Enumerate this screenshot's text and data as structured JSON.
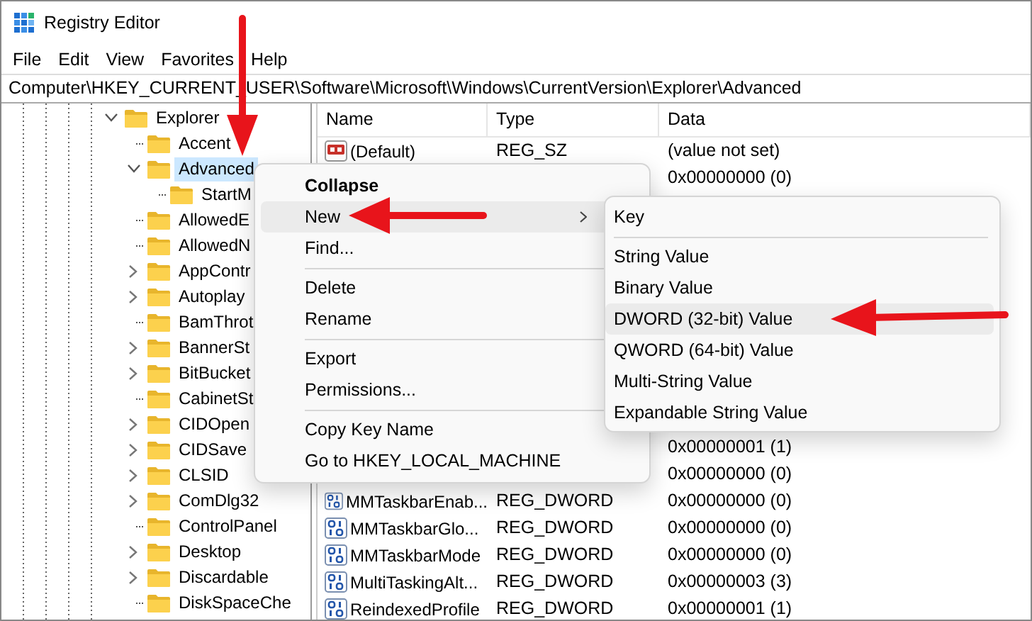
{
  "window": {
    "title": "Registry Editor"
  },
  "menu_bar": [
    "File",
    "Edit",
    "View",
    "Favorites",
    "Help"
  ],
  "address": "Computer\\HKEY_CURRENT_USER\\Software\\Microsoft\\Windows\\CurrentVersion\\Explorer\\Advanced",
  "tree": [
    {
      "label": "Explorer",
      "kind": "branch",
      "expanded": true,
      "selected": false,
      "children": [
        {
          "label": "Accent",
          "kind": "leaf",
          "selected": false
        },
        {
          "label": "Advanced",
          "kind": "branch",
          "expanded": true,
          "selected": true,
          "children": [
            {
              "label": "StartM",
              "kind": "leaf",
              "selected": false
            }
          ]
        },
        {
          "label": "AllowedE",
          "kind": "leaf",
          "selected": false
        },
        {
          "label": "AllowedN",
          "kind": "leaf",
          "selected": false
        },
        {
          "label": "AppContr",
          "kind": "branch",
          "expanded": false,
          "selected": false
        },
        {
          "label": "Autoplay",
          "kind": "branch",
          "expanded": false,
          "selected": false
        },
        {
          "label": "BamThrot",
          "kind": "leaf",
          "selected": false
        },
        {
          "label": "BannerSt",
          "kind": "branch",
          "expanded": false,
          "selected": false
        },
        {
          "label": "BitBucket",
          "kind": "branch",
          "expanded": false,
          "selected": false
        },
        {
          "label": "CabinetSt",
          "kind": "leaf",
          "selected": false
        },
        {
          "label": "CIDOpen",
          "kind": "branch",
          "expanded": false,
          "selected": false
        },
        {
          "label": "CIDSave",
          "kind": "branch",
          "expanded": false,
          "selected": false
        },
        {
          "label": "CLSID",
          "kind": "branch",
          "expanded": false,
          "selected": false
        },
        {
          "label": "ComDlg32",
          "kind": "branch",
          "expanded": false,
          "selected": false
        },
        {
          "label": "ControlPanel",
          "kind": "leaf",
          "selected": false
        },
        {
          "label": "Desktop",
          "kind": "branch",
          "expanded": false,
          "selected": false
        },
        {
          "label": "Discardable",
          "kind": "branch",
          "expanded": false,
          "selected": false
        },
        {
          "label": "DiskSpaceChe",
          "kind": "leaf",
          "selected": false
        }
      ]
    }
  ],
  "values": {
    "columns": [
      "Name",
      "Type",
      "Data"
    ],
    "rows": [
      {
        "kind": "string",
        "name": "(Default)",
        "type": "REG_SZ",
        "data": "(value not set)"
      },
      {
        "data": "0x00000000 (0)"
      },
      {
        "data": "0x00000001 (1)"
      },
      {
        "data": "0x00000000 (0)"
      },
      {
        "kind": "dword",
        "name": "MMTaskbarEnab...",
        "type": "REG_DWORD",
        "data": "0x00000000 (0)"
      },
      {
        "kind": "dword",
        "name": "MMTaskbarGlo...",
        "type": "REG_DWORD",
        "data": "0x00000000 (0)"
      },
      {
        "kind": "dword",
        "name": "MMTaskbarMode",
        "type": "REG_DWORD",
        "data": "0x00000000 (0)"
      },
      {
        "kind": "dword",
        "name": "MultiTaskingAlt...",
        "type": "REG_DWORD",
        "data": "0x00000003 (3)"
      },
      {
        "kind": "dword",
        "name": "ReindexedProfile",
        "type": "REG_DWORD",
        "data": "0x00000001 (1)"
      }
    ]
  },
  "context_menu": [
    {
      "kind": "item",
      "label": "Collapse",
      "default": true,
      "selected": false
    },
    {
      "kind": "item",
      "label": "New",
      "submenu": true,
      "selected": true
    },
    {
      "kind": "item",
      "label": "Find...",
      "selected": false
    },
    {
      "kind": "separator"
    },
    {
      "kind": "item",
      "label": "Delete",
      "selected": false
    },
    {
      "kind": "item",
      "label": "Rename",
      "selected": false
    },
    {
      "kind": "separator"
    },
    {
      "kind": "item",
      "label": "Export",
      "selected": false
    },
    {
      "kind": "item",
      "label": "Permissions...",
      "selected": false
    },
    {
      "kind": "separator"
    },
    {
      "kind": "item",
      "label": "Copy Key Name",
      "selected": false
    },
    {
      "kind": "item",
      "label": "Go to HKEY_LOCAL_MACHINE",
      "selected": false
    }
  ],
  "submenu": [
    {
      "kind": "item",
      "label": "Key",
      "selected": false
    },
    {
      "kind": "separator"
    },
    {
      "kind": "item",
      "label": "String Value",
      "selected": false
    },
    {
      "kind": "item",
      "label": "Binary Value",
      "selected": false
    },
    {
      "kind": "item",
      "label": "DWORD (32-bit) Value",
      "selected": true
    },
    {
      "kind": "item",
      "label": "QWORD (64-bit) Value",
      "selected": false
    },
    {
      "kind": "item",
      "label": "Multi-String Value",
      "selected": false
    },
    {
      "kind": "item",
      "label": "Expandable String Value",
      "selected": false
    }
  ]
}
